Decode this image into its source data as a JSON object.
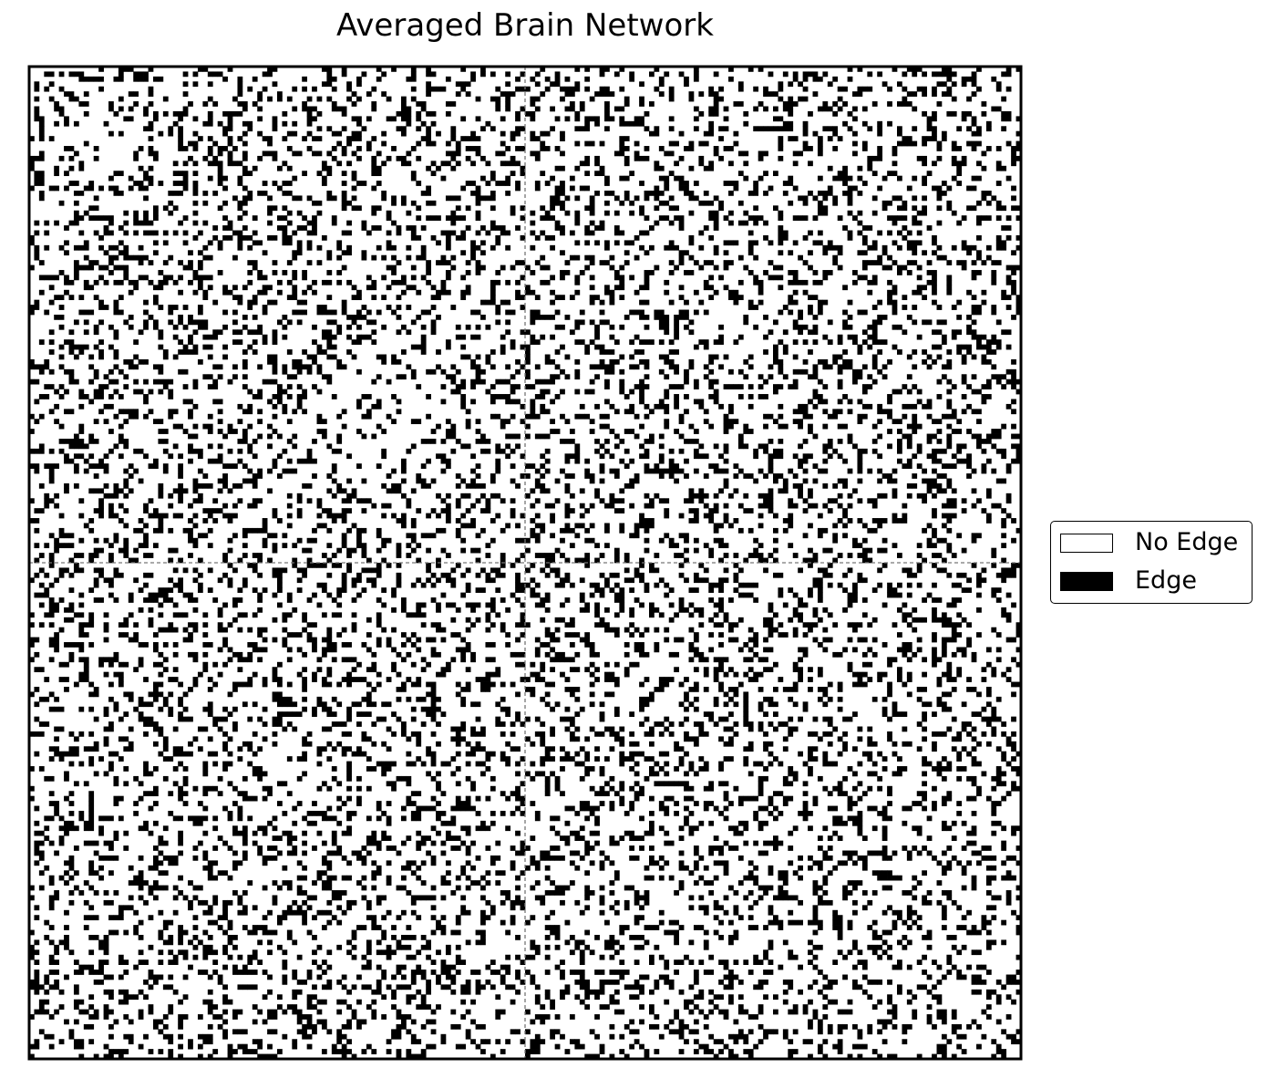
{
  "chart_data": {
    "type": "heatmap",
    "title": "Averaged Brain Network",
    "xlabel": "",
    "ylabel": "",
    "matrix_size": 200,
    "values": [
      0,
      1
    ],
    "value_labels": [
      "No Edge",
      "Edge"
    ],
    "colors": {
      "no_edge": "#ffffff",
      "edge": "#000000",
      "frame": "#000000",
      "divider": "#777777"
    },
    "edge_density": 0.24,
    "block_divider_index": 100,
    "grid": false,
    "legend_position": "right",
    "legend": [
      {
        "label": "No Edge",
        "color": "#ffffff"
      },
      {
        "label": "Edge",
        "color": "#000000"
      }
    ]
  }
}
